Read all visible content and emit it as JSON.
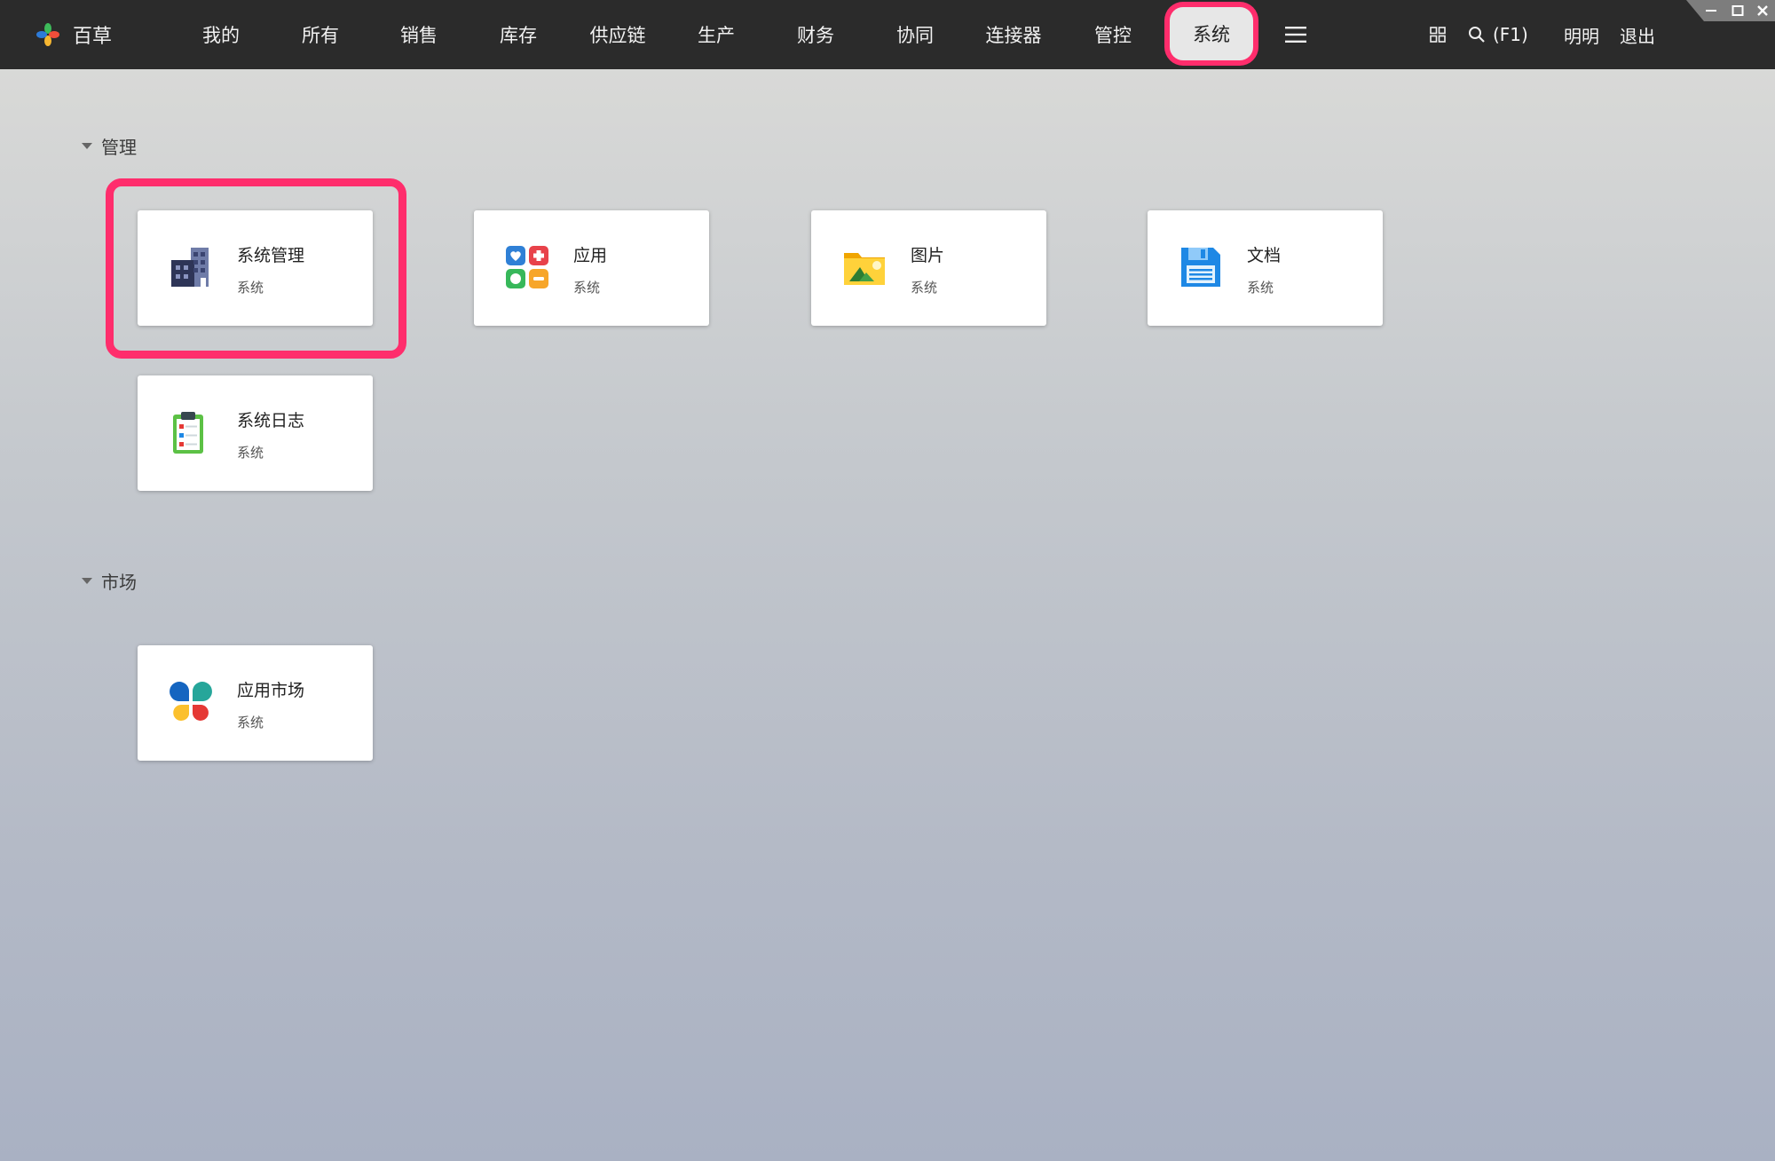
{
  "app": {
    "name": "百草"
  },
  "nav": {
    "items": [
      "我的",
      "所有",
      "销售",
      "库存",
      "供应链",
      "生产",
      "财务",
      "协同",
      "连接器",
      "管控",
      "系统"
    ],
    "active": "系统"
  },
  "toolbar": {
    "search_hint": "(F1)",
    "user": "明明",
    "logout": "退出"
  },
  "sections": [
    {
      "title": "管理",
      "cards": [
        {
          "title": "系统管理",
          "subtitle": "系统",
          "icon": "building-icon"
        },
        {
          "title": "应用",
          "subtitle": "系统",
          "icon": "apps-icon"
        },
        {
          "title": "图片",
          "subtitle": "系统",
          "icon": "image-folder-icon"
        },
        {
          "title": "文档",
          "subtitle": "系统",
          "icon": "floppy-document-icon"
        },
        {
          "title": "系统日志",
          "subtitle": "系统",
          "icon": "clipboard-icon"
        }
      ]
    },
    {
      "title": "市场",
      "cards": [
        {
          "title": "应用市场",
          "subtitle": "系统",
          "icon": "petals-icon"
        }
      ]
    }
  ],
  "colors": {
    "topbar": "#2b2b2b",
    "highlight": "#ff2d6c",
    "active_tab_bg": "#e7e7e7"
  }
}
